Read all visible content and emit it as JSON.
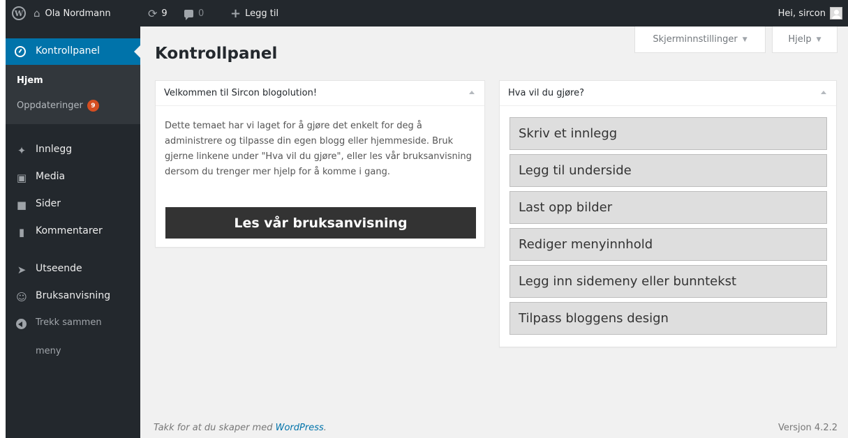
{
  "adminbar": {
    "site_name": "Ola Nordmann",
    "updates_count": "9",
    "comments_count": "0",
    "new_label": "Legg til",
    "account_greeting": "Hei, sircon"
  },
  "sidebar": {
    "current": "Kontrollpanel",
    "submenu": {
      "home": "Hjem",
      "updates": "Oppdateringer",
      "updates_badge": "9"
    },
    "items": [
      {
        "label": "Innlegg",
        "icon": "pin-icon"
      },
      {
        "label": "Media",
        "icon": "media-icon"
      },
      {
        "label": "Sider",
        "icon": "pages-icon"
      },
      {
        "label": "Kommentarer",
        "icon": "comments-icon"
      },
      {
        "label": "Utseende",
        "icon": "appearance-icon"
      },
      {
        "label": "Bruksanvisning",
        "icon": "smiley-icon"
      }
    ],
    "collapse_line1": "Trekk sammen",
    "collapse_line2": "meny"
  },
  "screen_options": {
    "options_label": "Skjerminnstillinger",
    "help_label": "Hjelp"
  },
  "page": {
    "title": "Kontrollpanel"
  },
  "welcome": {
    "title": "Velkommen til Sircon blogolution!",
    "text": "Dette temaet har vi laget for å gjøre det enkelt for deg å administrere og tilpasse din egen blogg eller hjemmeside. Bruk gjerne linkene under \"Hva vil du gjøre\", eller les vår bruksanvisning dersom du trenger mer hjelp for å komme i gang.",
    "button": "Les vår bruksanvisning"
  },
  "actions": {
    "title": "Hva vil du gjøre?",
    "items": [
      "Skriv et innlegg",
      "Legg til underside",
      "Last opp bilder",
      "Rediger menyinnhold",
      "Legg inn sidemeny eller bunntekst",
      "Tilpass bloggens design"
    ]
  },
  "footer": {
    "thanks_prefix": "Takk for at du skaper med ",
    "thanks_link": "WordPress",
    "thanks_suffix": ".",
    "version": "Versjon 4.2.2"
  },
  "colors": {
    "adminbar": "#23282d",
    "accent": "#0073aa",
    "badge": "#d54e21",
    "background": "#f1f1f1"
  }
}
